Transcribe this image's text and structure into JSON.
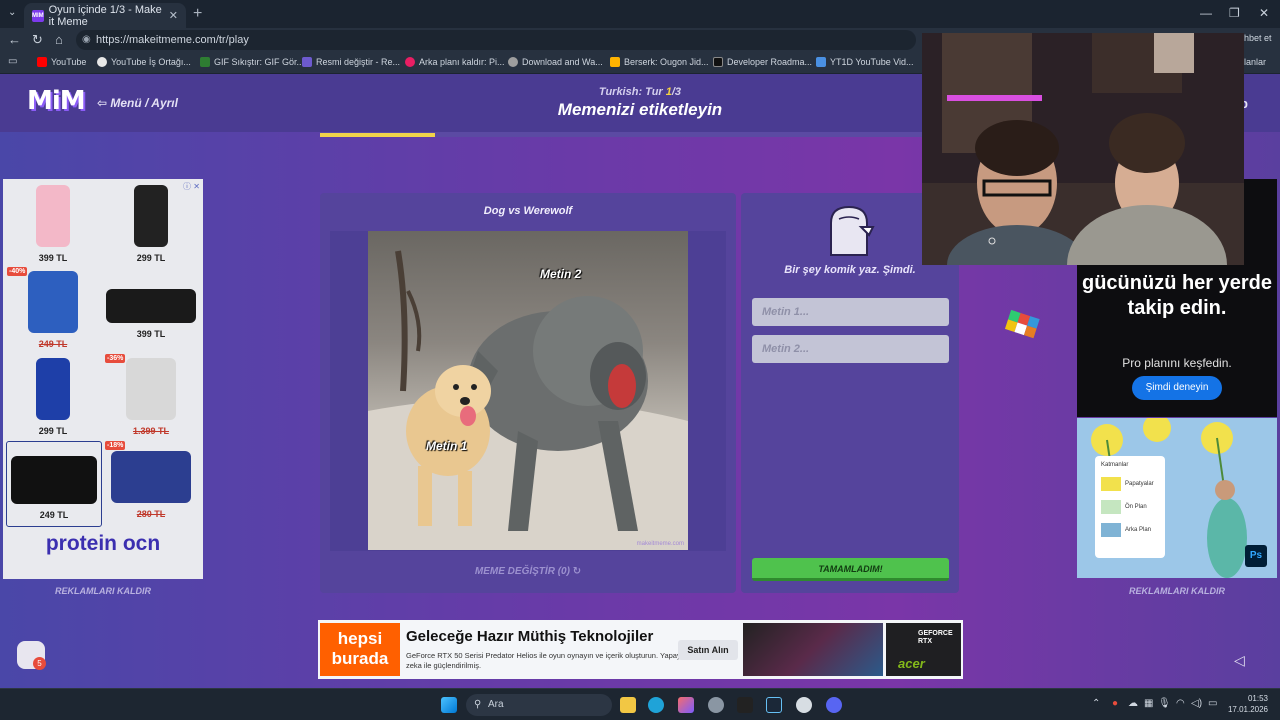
{
  "browser": {
    "tab_title": "Oyun içinde 1/3 - Make it Meme",
    "favicon_text": "MIM",
    "url": "https://makeitmeme.com/tr/play",
    "profile_partial": "hbet et",
    "bookmarks": [
      {
        "label": "YouTube",
        "color": "#ff0000"
      },
      {
        "label": "YouTube İş Ortağı...",
        "color": "#e8e8e8"
      },
      {
        "label": "GIF Sıkıştır: GIF Gör...",
        "color": "#2e7d32"
      },
      {
        "label": "Resmi değiştir - Re...",
        "color": "#6d5acf"
      },
      {
        "label": "Arka planı kaldır: Pi...",
        "color": "#e91e63"
      },
      {
        "label": "Download and Wa...",
        "color": "#9e9e9e"
      },
      {
        "label": "Berserk: Ougon Jid...",
        "color": "#ffb300"
      },
      {
        "label": "Developer Roadma...",
        "color": "#111111"
      },
      {
        "label": "YT1D YouTube Vid...",
        "color": "#4a90e2"
      }
    ],
    "bookmarks_right": "lanlar"
  },
  "game": {
    "logo": "MiM",
    "menu_label": "⇦ Menü / Ayrıl",
    "round_prefix": "Turkish: Tur ",
    "round_current": "1",
    "round_suffix": "/3",
    "page_title": "Memenizi etiketleyin",
    "header_right": "p",
    "progress": 0.18
  },
  "meme": {
    "title": "Dog vs Werewolf",
    "label_1": "Metin 1",
    "label_2": "Metin 2",
    "watermark": "makeitmeme.com",
    "change_label": "MEME DEĞİŞTİR (0)",
    "change_icon": "↻"
  },
  "caption": {
    "prompt": "Bir şey komik yaz. Şimdi.",
    "input_1_placeholder": "Metin 1...",
    "input_2_placeholder": "Metin 2...",
    "done_label": "TAMAMLADIM!"
  },
  "ads": {
    "left_products": [
      {
        "price": "399 TL",
        "color": "#f3b8c8"
      },
      {
        "price": "299 TL",
        "color": "#222222"
      },
      {
        "price": "249 TL",
        "old": true,
        "badge": "-40%",
        "color": "#2d5fbf"
      },
      {
        "price": "399 TL",
        "color": "#1a1a1a"
      },
      {
        "price": "299 TL",
        "color": "#1e3fa8"
      },
      {
        "price": "1.399 TL",
        "old": true,
        "badge": "-36%",
        "color": "#d8d8d8"
      },
      {
        "price": "249 TL",
        "color": "#111111"
      },
      {
        "price": "280 TL",
        "old": true,
        "badge": "-18%",
        "color": "#2c3e90"
      }
    ],
    "left_brand": "protein ocn",
    "remove_ads": "REKLAMLARI KALDIR",
    "right_top_text": "gücünüzü her yerde takip edin.",
    "right_top_sub": "Pro planını keşfedin.",
    "right_top_btn": "Şimdi deneyin",
    "right_bottom_layers": [
      "Katmanlar",
      "Papatyalar",
      "Ön Plan",
      "Arka Plan"
    ],
    "right_bottom_badge": "Ps",
    "bottom_brand": "hepsi burada",
    "bottom_headline": "Geleceğe Hazır Müthiş Teknolojiler",
    "bottom_sub": "GeForce RTX 50 Serisi Predator Helios ile oyun oynayın ve içerik oluşturun. Yapay zeka ile güçlendirilmiş.",
    "bottom_btn": "Satın Alın",
    "bottom_gpu": "GEFORCE RTX",
    "bottom_maker": "acer"
  },
  "chat": {
    "badge": "5"
  },
  "taskbar": {
    "search_placeholder": "Ara",
    "time": "01:53",
    "date": "17.01.2026"
  }
}
